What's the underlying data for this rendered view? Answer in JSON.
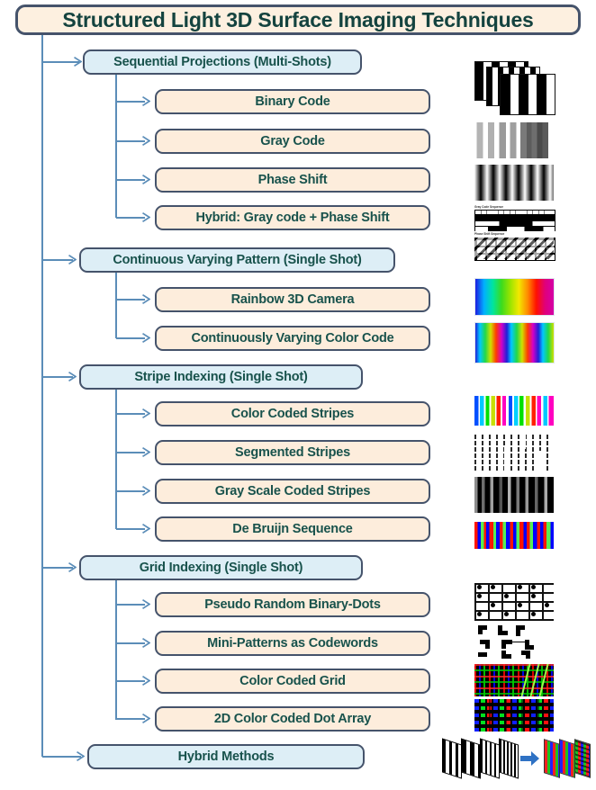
{
  "title": {
    "text": "Structured Light 3D Surface Imaging Techniques"
  },
  "groups": [
    {
      "label": "Sequential Projections (Multi-Shots)",
      "children": [
        {
          "label": "Binary Code",
          "thumb": "binary-code-pattern-stack"
        },
        {
          "label": "Gray Code",
          "thumb": "gray-code-bars"
        },
        {
          "label": "Phase Shift",
          "thumb": "phase-shift-sinusoid-stripes"
        },
        {
          "label": "Hybrid: Gray code + Phase Shift",
          "thumb": "gray-code-plus-phase-shift-sequence"
        }
      ]
    },
    {
      "label": "Continuous Varying Pattern (Single Shot)",
      "children": [
        {
          "label": "Rainbow 3D Camera",
          "thumb": "rainbow-gradient"
        },
        {
          "label": "Continuously Varying Color Code",
          "thumb": "repeating-rainbow-gradient"
        }
      ]
    },
    {
      "label": "Stripe Indexing (Single Shot)",
      "children": [
        {
          "label": "Color Coded Stripes",
          "thumb": "color-coded-stripes"
        },
        {
          "label": "Segmented Stripes",
          "thumb": "segmented-dashed-stripes"
        },
        {
          "label": "Gray Scale Coded Stripes",
          "thumb": "gray-scale-coded-stripes"
        },
        {
          "label": "De Bruijn Sequence",
          "thumb": "de-bruijn-color-stripes"
        }
      ]
    },
    {
      "label": "Grid Indexing (Single Shot)",
      "children": [
        {
          "label": "Pseudo Random Binary-Dots",
          "thumb": "pseudo-random-binary-dot-grid"
        },
        {
          "label": "Mini-Patterns as Codewords",
          "thumb": "mini-pattern-codewords"
        },
        {
          "label": "Color Coded Grid",
          "thumb": "color-coded-grid"
        },
        {
          "label": "2D Color Coded Dot Array",
          "thumb": "two-d-color-coded-dot-array"
        }
      ]
    },
    {
      "label": "Hybrid Methods",
      "children": [],
      "thumb": "hybrid-methods-illustration"
    }
  ],
  "thumb_labels": {
    "gray_code_sequence": "Gray Code Sequence",
    "phase_shift_sequence": "Phase Shift Sequence"
  },
  "colors": {
    "title_fill": "#fdf0e0",
    "level1_fill": "#ddeef6",
    "level2_fill": "#fdeddc",
    "box_border": "#45536b",
    "connector": "#5b8db8",
    "text": "#18524c"
  }
}
